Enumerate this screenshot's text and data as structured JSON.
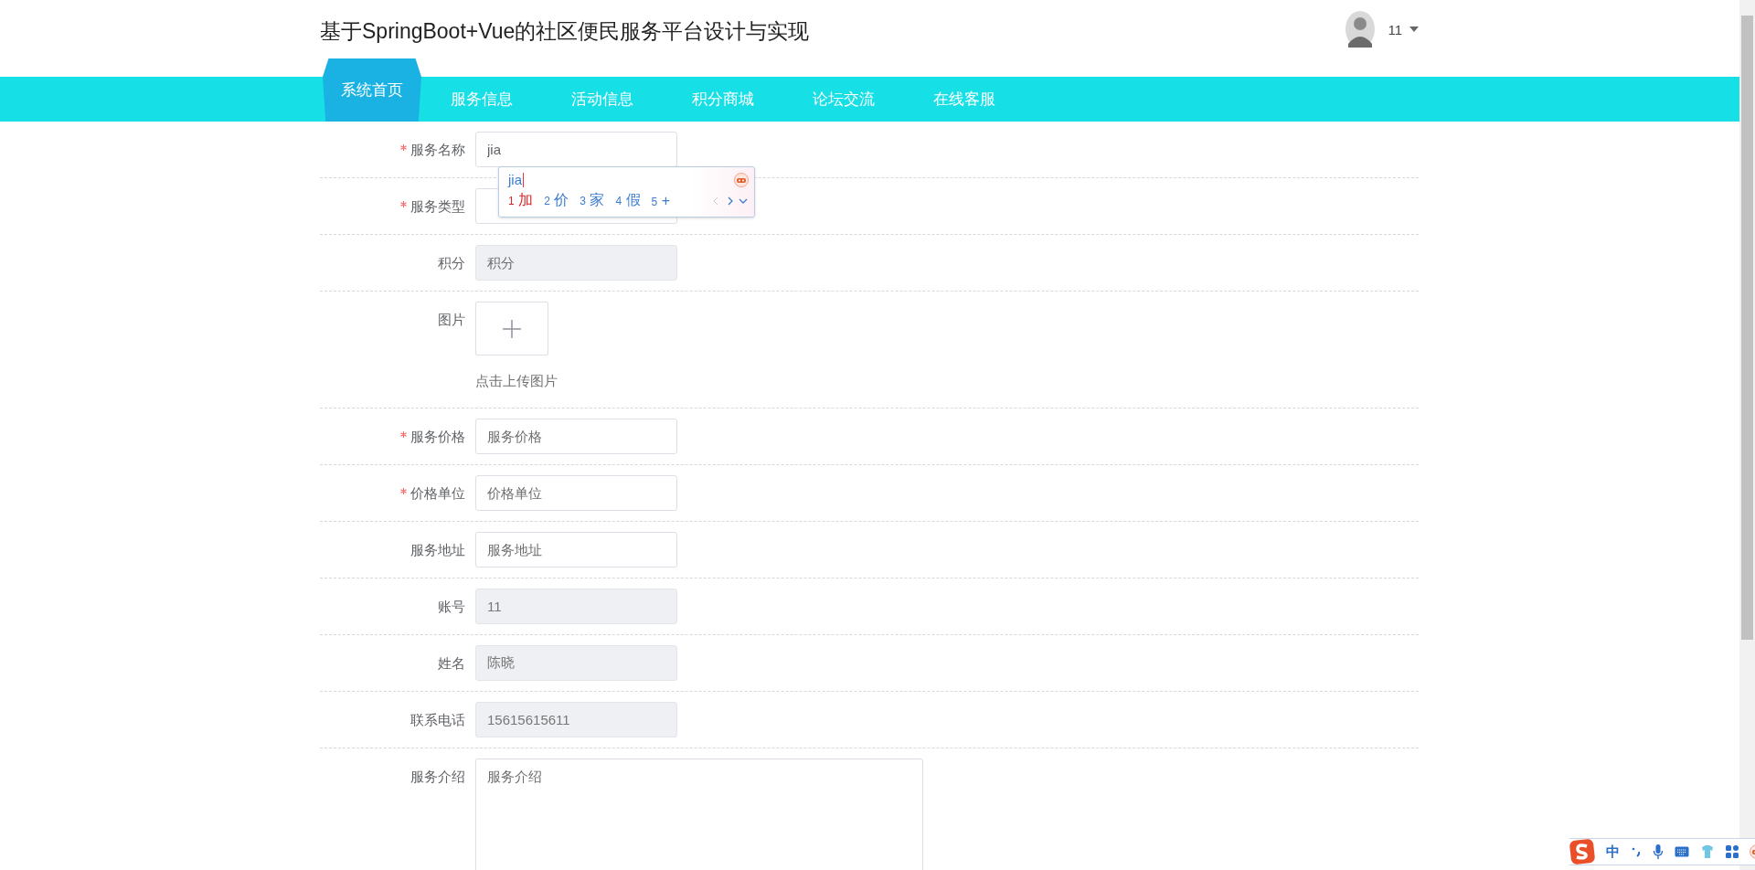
{
  "header": {
    "title": "基于SpringBoot+Vue的社区便民服务平台设计与实现",
    "user": {
      "name": "11"
    }
  },
  "nav": [
    {
      "label": "系统首页",
      "selected": true
    },
    {
      "label": "服务信息",
      "selected": false
    },
    {
      "label": "活动信息",
      "selected": false
    },
    {
      "label": "积分商城",
      "selected": false
    },
    {
      "label": "论坛交流",
      "selected": false
    },
    {
      "label": "在线客服",
      "selected": false
    }
  ],
  "form": {
    "fields": [
      {
        "kind": "input",
        "label": "服务名称",
        "required": true,
        "disabled": false,
        "value": "jia"
      },
      {
        "kind": "select",
        "label": "服务类型",
        "required": true,
        "disabled": false
      },
      {
        "kind": "input",
        "label": "积分",
        "required": false,
        "disabled": true,
        "placeholder": "积分"
      },
      {
        "kind": "upload",
        "label": "图片",
        "required": false,
        "disabled": false,
        "hint": "点击上传图片"
      },
      {
        "kind": "input",
        "label": "服务价格",
        "required": true,
        "disabled": false,
        "placeholder": "服务价格"
      },
      {
        "kind": "input",
        "label": "价格单位",
        "required": true,
        "disabled": false,
        "placeholder": "价格单位"
      },
      {
        "kind": "input",
        "label": "服务地址",
        "required": false,
        "disabled": false,
        "placeholder": "服务地址"
      },
      {
        "kind": "input",
        "label": "账号",
        "required": false,
        "disabled": true,
        "value": "11"
      },
      {
        "kind": "input",
        "label": "姓名",
        "required": false,
        "disabled": true,
        "value": "陈晓"
      },
      {
        "kind": "input",
        "label": "联系电话",
        "required": false,
        "disabled": true,
        "value": "15615615611"
      },
      {
        "kind": "textarea",
        "label": "服务介绍",
        "required": false,
        "disabled": false,
        "placeholder": "服务介绍"
      }
    ]
  },
  "ime_popup": {
    "composition": "jia",
    "candidates": [
      {
        "index": "1",
        "text": "加",
        "selected": true
      },
      {
        "index": "2",
        "text": "价",
        "selected": false
      },
      {
        "index": "3",
        "text": "家",
        "selected": false
      },
      {
        "index": "4",
        "text": "假",
        "selected": false
      },
      {
        "index": "5",
        "text": "+",
        "selected": false
      }
    ]
  },
  "ime_toolbar": {
    "mode": "中"
  }
}
